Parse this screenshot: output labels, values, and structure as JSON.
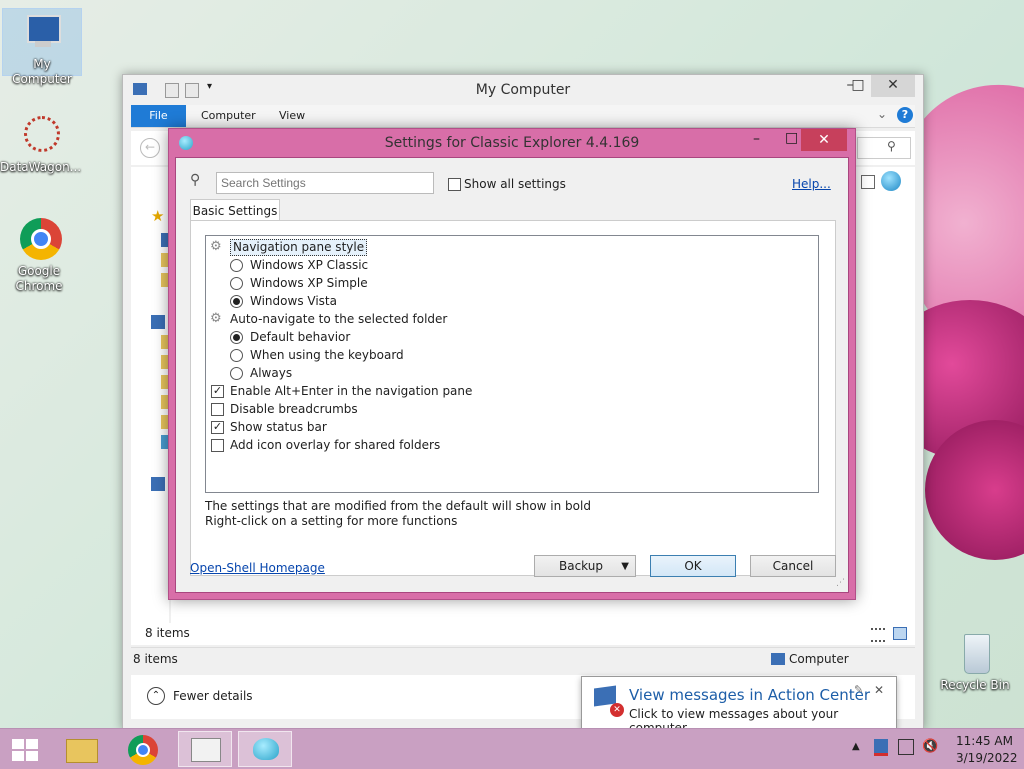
{
  "desktop": {
    "icons": [
      {
        "label": "My Computer"
      },
      {
        "label": "DataWagon..."
      },
      {
        "label": "Google Chrome"
      },
      {
        "label": "Recycle Bin"
      }
    ]
  },
  "explorer": {
    "title": "My Computer",
    "ribbon_tabs": [
      "File",
      "Computer",
      "View"
    ],
    "status_items": "8 items",
    "status_items_bottom": "8 items",
    "status_location": "Computer",
    "fewer_details": "Fewer details"
  },
  "dialog": {
    "title": "Settings for Classic Explorer 4.4.169",
    "search_placeholder": "Search Settings",
    "show_all": "Show all settings",
    "help": "Help...",
    "tab": "Basic Settings",
    "settings": [
      {
        "kind": "group",
        "label": "Navigation pane style"
      },
      {
        "kind": "radio",
        "label": "Windows XP Classic",
        "checked": false
      },
      {
        "kind": "radio",
        "label": "Windows XP Simple",
        "checked": false
      },
      {
        "kind": "radio",
        "label": "Windows Vista",
        "checked": true
      },
      {
        "kind": "group",
        "label": "Auto-navigate to the selected folder"
      },
      {
        "kind": "radio",
        "label": "Default behavior",
        "checked": true
      },
      {
        "kind": "radio",
        "label": "When using the keyboard",
        "checked": false
      },
      {
        "kind": "radio",
        "label": "Always",
        "checked": false
      },
      {
        "kind": "check",
        "label": "Enable Alt+Enter in the navigation pane",
        "checked": true
      },
      {
        "kind": "check",
        "label": "Disable breadcrumbs",
        "checked": false
      },
      {
        "kind": "check",
        "label": "Show status bar",
        "checked": true
      },
      {
        "kind": "check",
        "label": "Add icon overlay for shared folders",
        "checked": false
      }
    ],
    "hint1": "The settings that are modified from the default will show in bold",
    "hint2": "Right-click on a setting for more functions",
    "homepage": "Open-Shell Homepage",
    "backup": "Backup",
    "ok": "OK",
    "cancel": "Cancel"
  },
  "notification": {
    "title": "View messages in Action Center",
    "body": "Click to view messages about your computer."
  },
  "clock": {
    "time": "11:45 AM",
    "date": "3/19/2022"
  },
  "colors": {
    "accent": "#1f7bd6",
    "dialog_border": "#d86ea8",
    "taskbar": "#c9a0c2"
  }
}
